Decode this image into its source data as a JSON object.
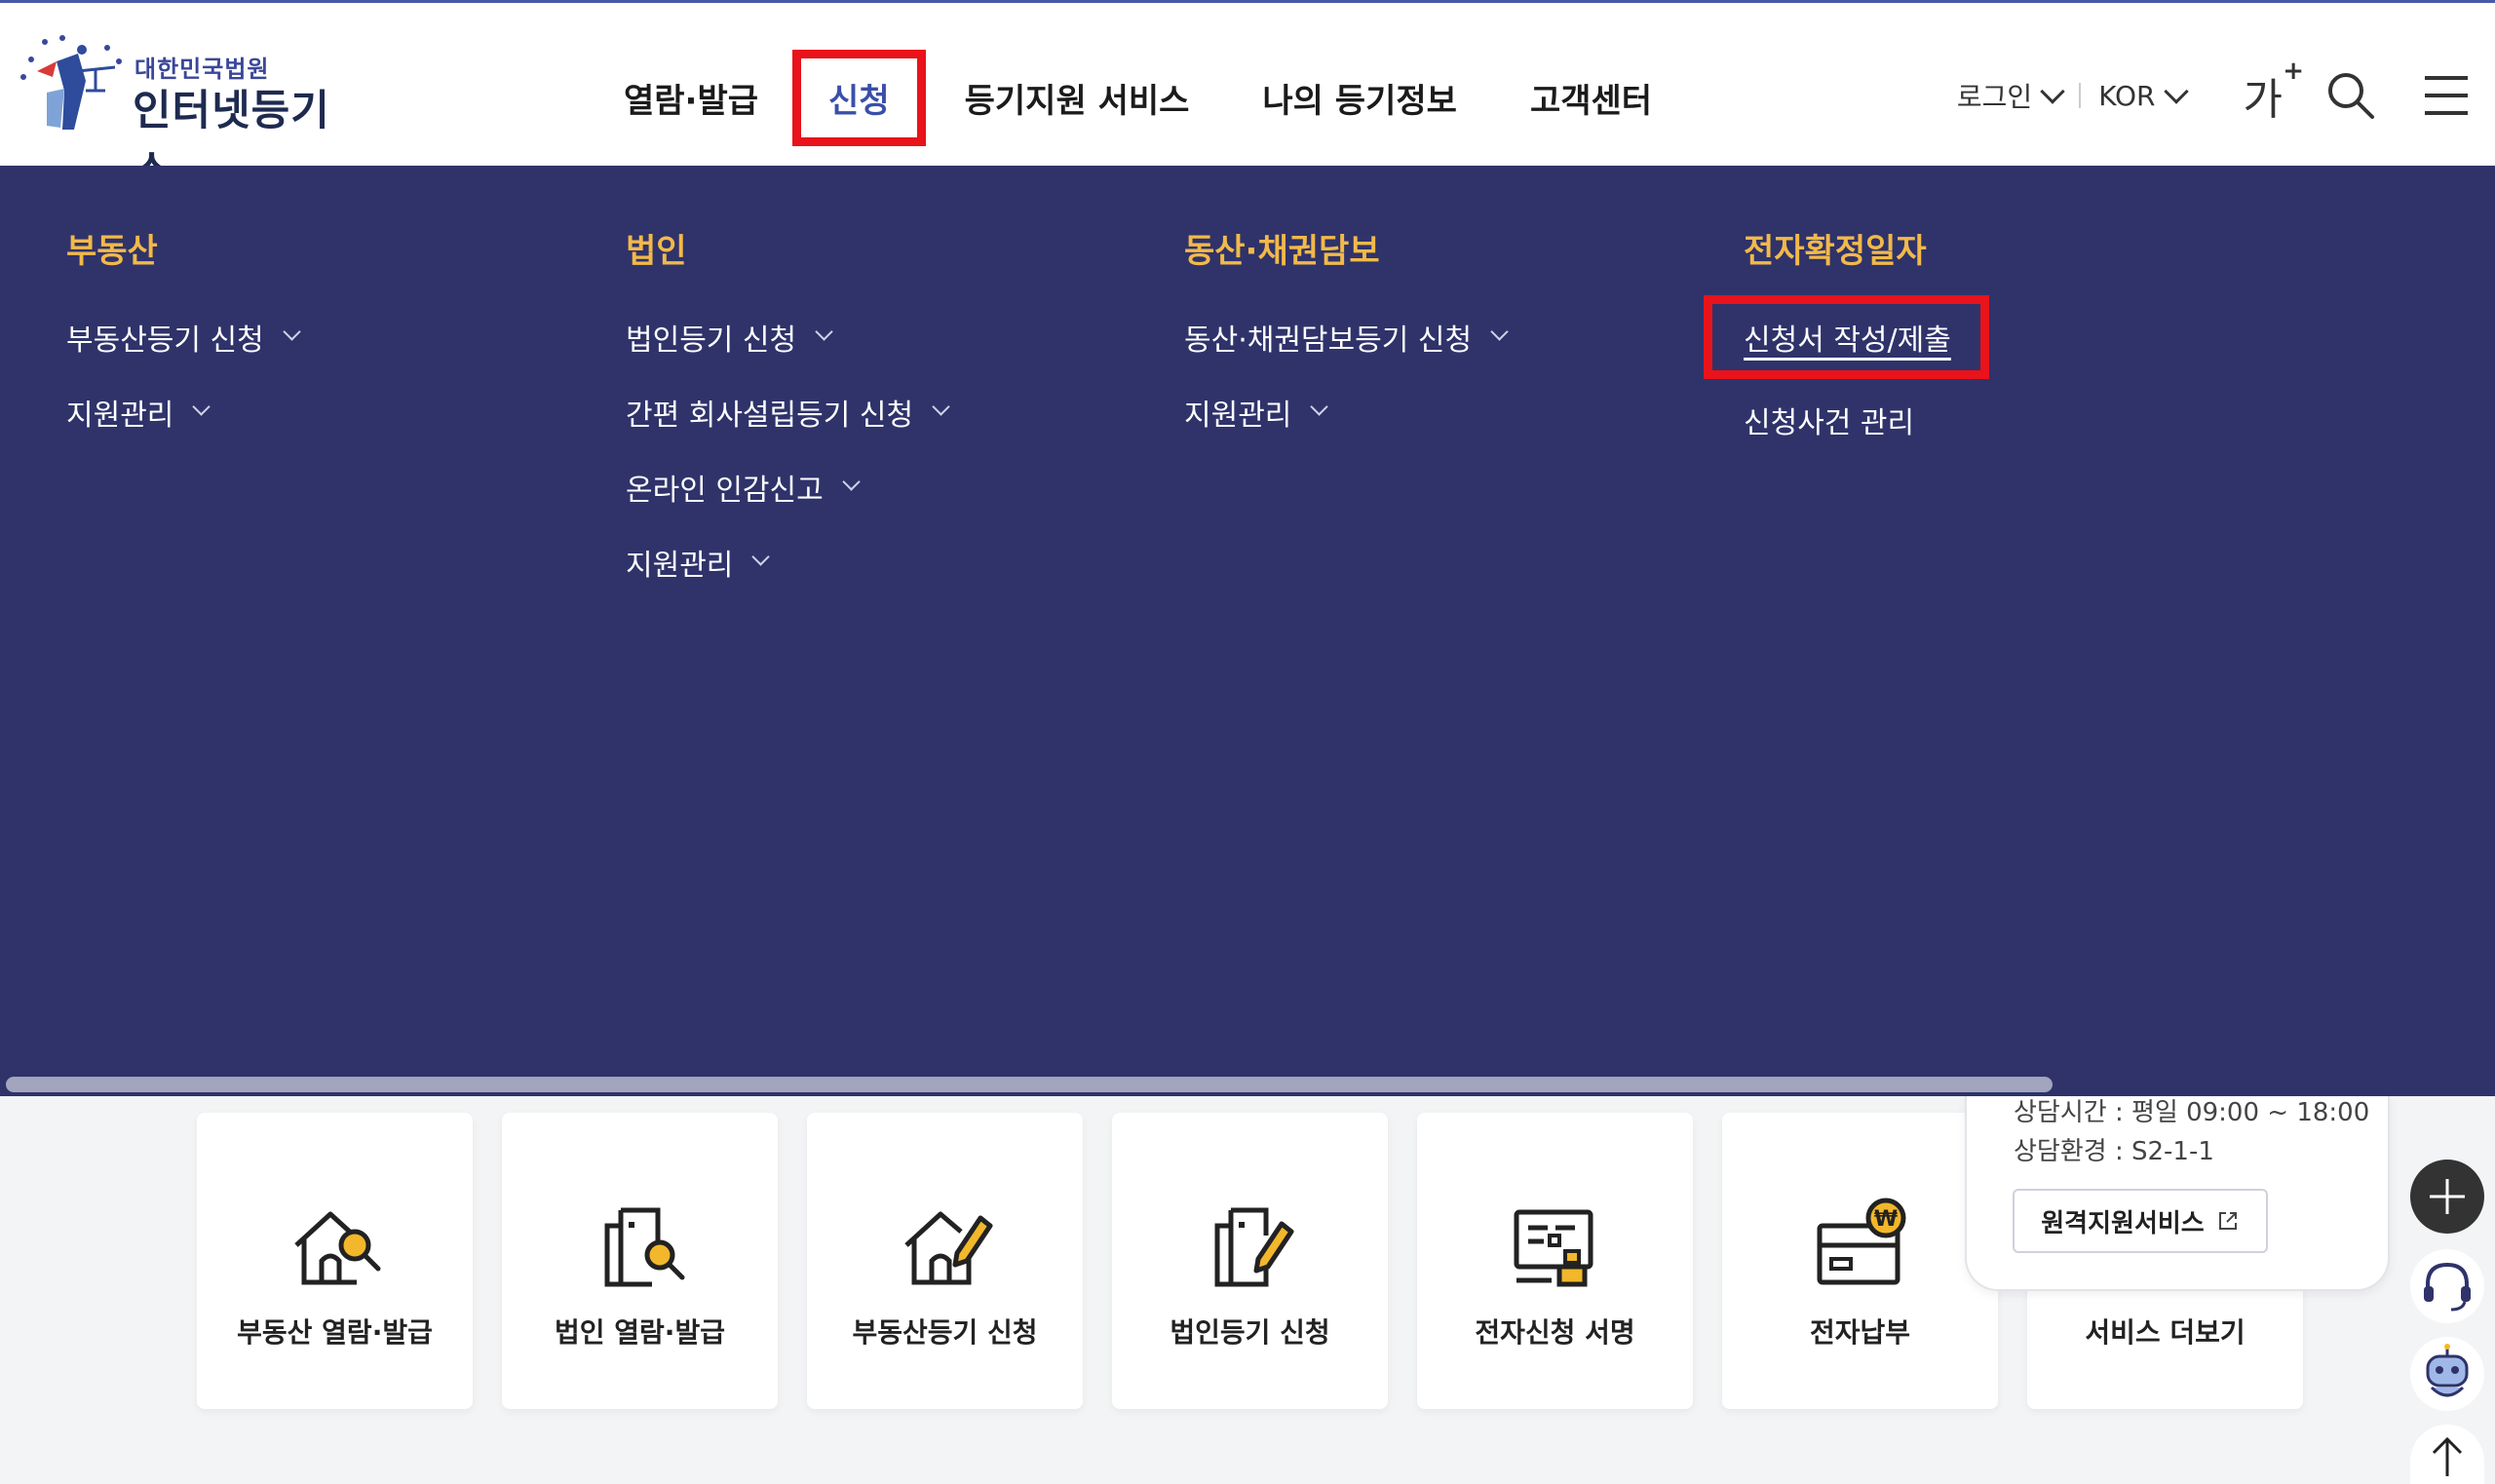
{
  "header": {
    "logo_sub": "대한민국법원",
    "logo_main": "인터넷등기소",
    "nav": [
      {
        "label": "열람·발급"
      },
      {
        "label": "신청"
      },
      {
        "label": "등기지원 서비스"
      },
      {
        "label": "나의 등기정보"
      },
      {
        "label": "고객센터"
      }
    ],
    "login_label": "로그인",
    "language_label": "KOR",
    "font_size_label": "가",
    "font_size_plus": "+"
  },
  "mega_menu": {
    "columns": [
      {
        "title": "부동산",
        "items": [
          {
            "label": "부동산등기 신청"
          },
          {
            "label": "지원관리"
          }
        ]
      },
      {
        "title": "법인",
        "items": [
          {
            "label": "법인등기 신청"
          },
          {
            "label": "간편 회사설립등기 신청"
          },
          {
            "label": "온라인 인감신고"
          },
          {
            "label": "지원관리"
          }
        ]
      },
      {
        "title": "동산·채권담보",
        "items": [
          {
            "label": "동산·채권담보등기 신청"
          },
          {
            "label": "지원관리"
          }
        ]
      },
      {
        "title": "전자확정일자",
        "items": [
          {
            "label": "신청서 작성/제출"
          },
          {
            "label": "신청사건 관리"
          }
        ]
      }
    ]
  },
  "quick_menu": [
    {
      "label": "부동산 열람·발급",
      "icon": "house-search-icon"
    },
    {
      "label": "법인 열람·발급",
      "icon": "building-search-icon"
    },
    {
      "label": "부동산등기 신청",
      "icon": "house-edit-icon"
    },
    {
      "label": "법인등기 신청",
      "icon": "building-edit-icon"
    },
    {
      "label": "전자신청 서명",
      "icon": "document-stamp-icon"
    },
    {
      "label": "전자납부",
      "icon": "card-won-icon"
    },
    {
      "label": "서비스 더보기",
      "icon": "more-services-icon"
    }
  ],
  "remote_popup": {
    "hours": "상담시간 : 평일 09:00 ~ 18:00",
    "env": "상담환경 : S2-1-1",
    "button_label": "원격지원서비스"
  },
  "colors": {
    "menu_bg": "#2f336a",
    "menu_title": "#f2b94a",
    "highlight_box": "#e8131b",
    "active_nav": "#3a4fa8"
  }
}
